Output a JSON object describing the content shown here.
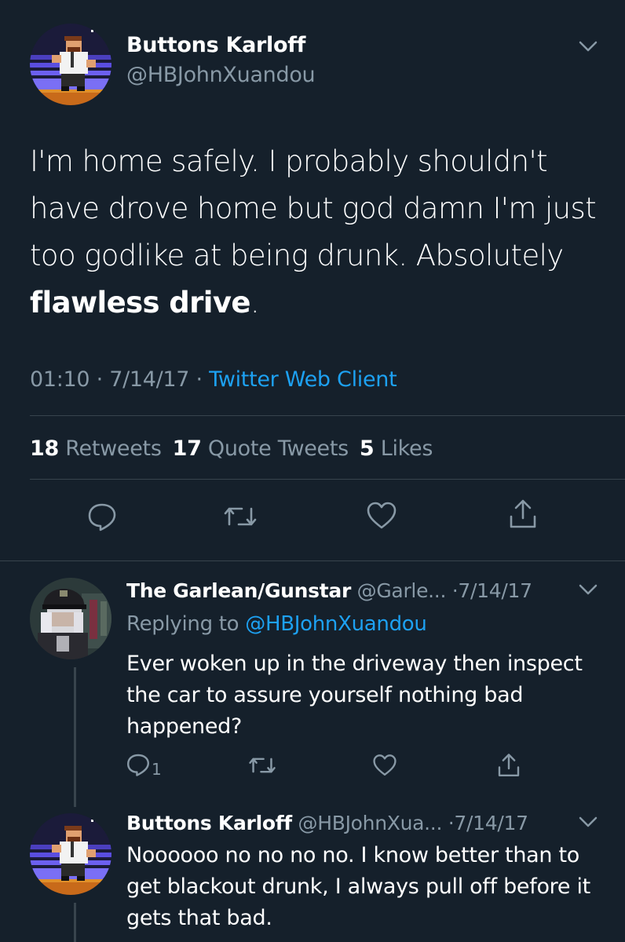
{
  "main_tweet": {
    "author_name": "Buttons Karloff",
    "author_handle": "@HBJohnXuandou",
    "text_part1": "I'm home safely. I probably shouldn't have drove home but god damn I'm just too godlike at being drunk. Absolutely ",
    "text_bold": "flawless drive",
    "text_end": ".",
    "time": "01:10",
    "date": "7/14/17",
    "sep": "·",
    "client": "Twitter Web Client",
    "retweets_count": "18",
    "retweets_label": "Retweets",
    "quotes_count": "17",
    "quotes_label": "Quote Tweets",
    "likes_count": "5",
    "likes_label": "Likes"
  },
  "replies": [
    {
      "author_name": "The Garlean/Gunstar",
      "author_handle": "@Garle...",
      "date": "·7/14/17",
      "replying_prefix": "Replying to",
      "replying_to": "@HBJohnXuandou",
      "text": "Ever woken up in the driveway then inspect the car to assure yourself nothing bad happened?",
      "reply_count": "1"
    },
    {
      "author_name": "Buttons Karloff",
      "author_handle": "@HBJohnXua...",
      "date": "·7/14/17",
      "text": "Noooooo no no no no. I know better than to get blackout drunk, I always pull off before it gets that bad."
    }
  ],
  "icons": [
    "chevron-down-icon",
    "reply-icon",
    "retweet-icon",
    "like-icon",
    "share-icon"
  ],
  "colors": {
    "background": "#15202b",
    "text": "#ffffff",
    "muted": "#8899a6",
    "link": "#1da1f2",
    "divider": "#38444d"
  }
}
